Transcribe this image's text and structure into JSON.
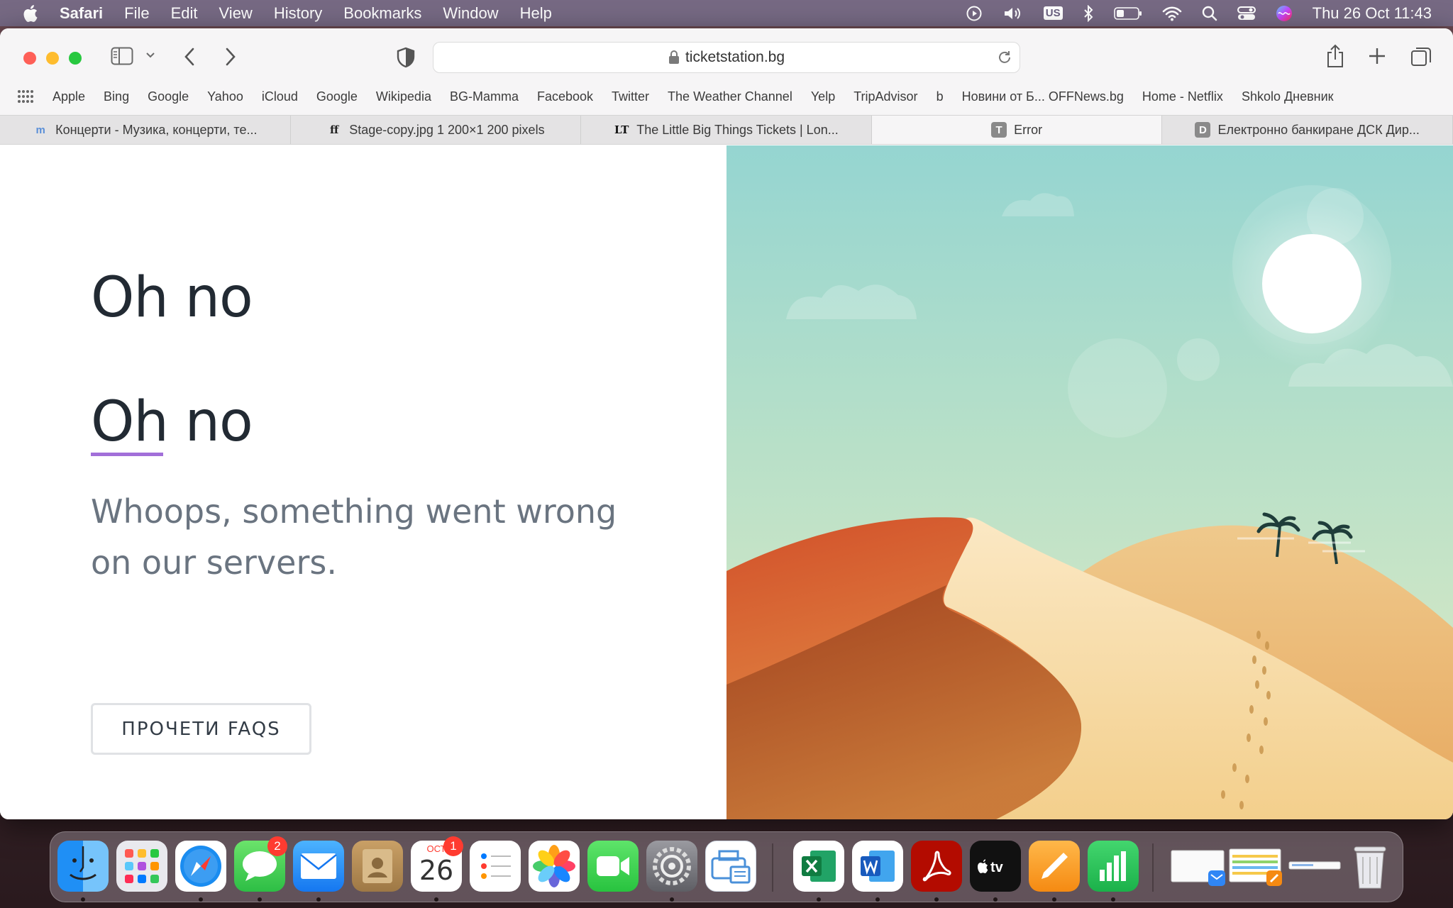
{
  "menubar": {
    "app_name": "Safari",
    "items": [
      "File",
      "Edit",
      "View",
      "History",
      "Bookmarks",
      "Window",
      "Help"
    ],
    "input_source": "US",
    "clock": "Thu 26 Oct  11:43"
  },
  "toolbar": {
    "url": "ticketstation.bg"
  },
  "favorites": [
    "Apple",
    "Bing",
    "Google",
    "Yahoo",
    "iCloud",
    "Google",
    "Wikipedia",
    "BG-Mamma",
    "Facebook",
    "Twitter",
    "The Weather Channel",
    "Yelp",
    "TripAdvisor",
    "b",
    "Новини от Б... OFFNews.bg",
    "Home - Netflix",
    "Shkolo Дневник"
  ],
  "tabs": [
    {
      "label": "Концерти - Музика, концерти, те...",
      "icon": "m",
      "active": false
    },
    {
      "label": "Stage-copy.jpg 1 200×1 200 pixels",
      "icon": "ff",
      "active": false
    },
    {
      "label": "The Little Big Things Tickets | Lon...",
      "icon": "LT",
      "active": false
    },
    {
      "label": "Error",
      "icon": "T",
      "active": true
    },
    {
      "label": "Електронно банкиране ДСК Дир...",
      "icon": "D",
      "active": false
    }
  ],
  "page": {
    "heading_1": "Oh no",
    "heading_2": "Oh no",
    "message": "Whoops, something went wrong on our servers.",
    "faq_button": "ПРОЧЕТИ FAQS",
    "accent_color": "#a26fd9"
  },
  "dock": {
    "messages_badge": "2",
    "calendar_month": "ОСТ",
    "calendar_day": "26",
    "calendar_badge": "1"
  }
}
